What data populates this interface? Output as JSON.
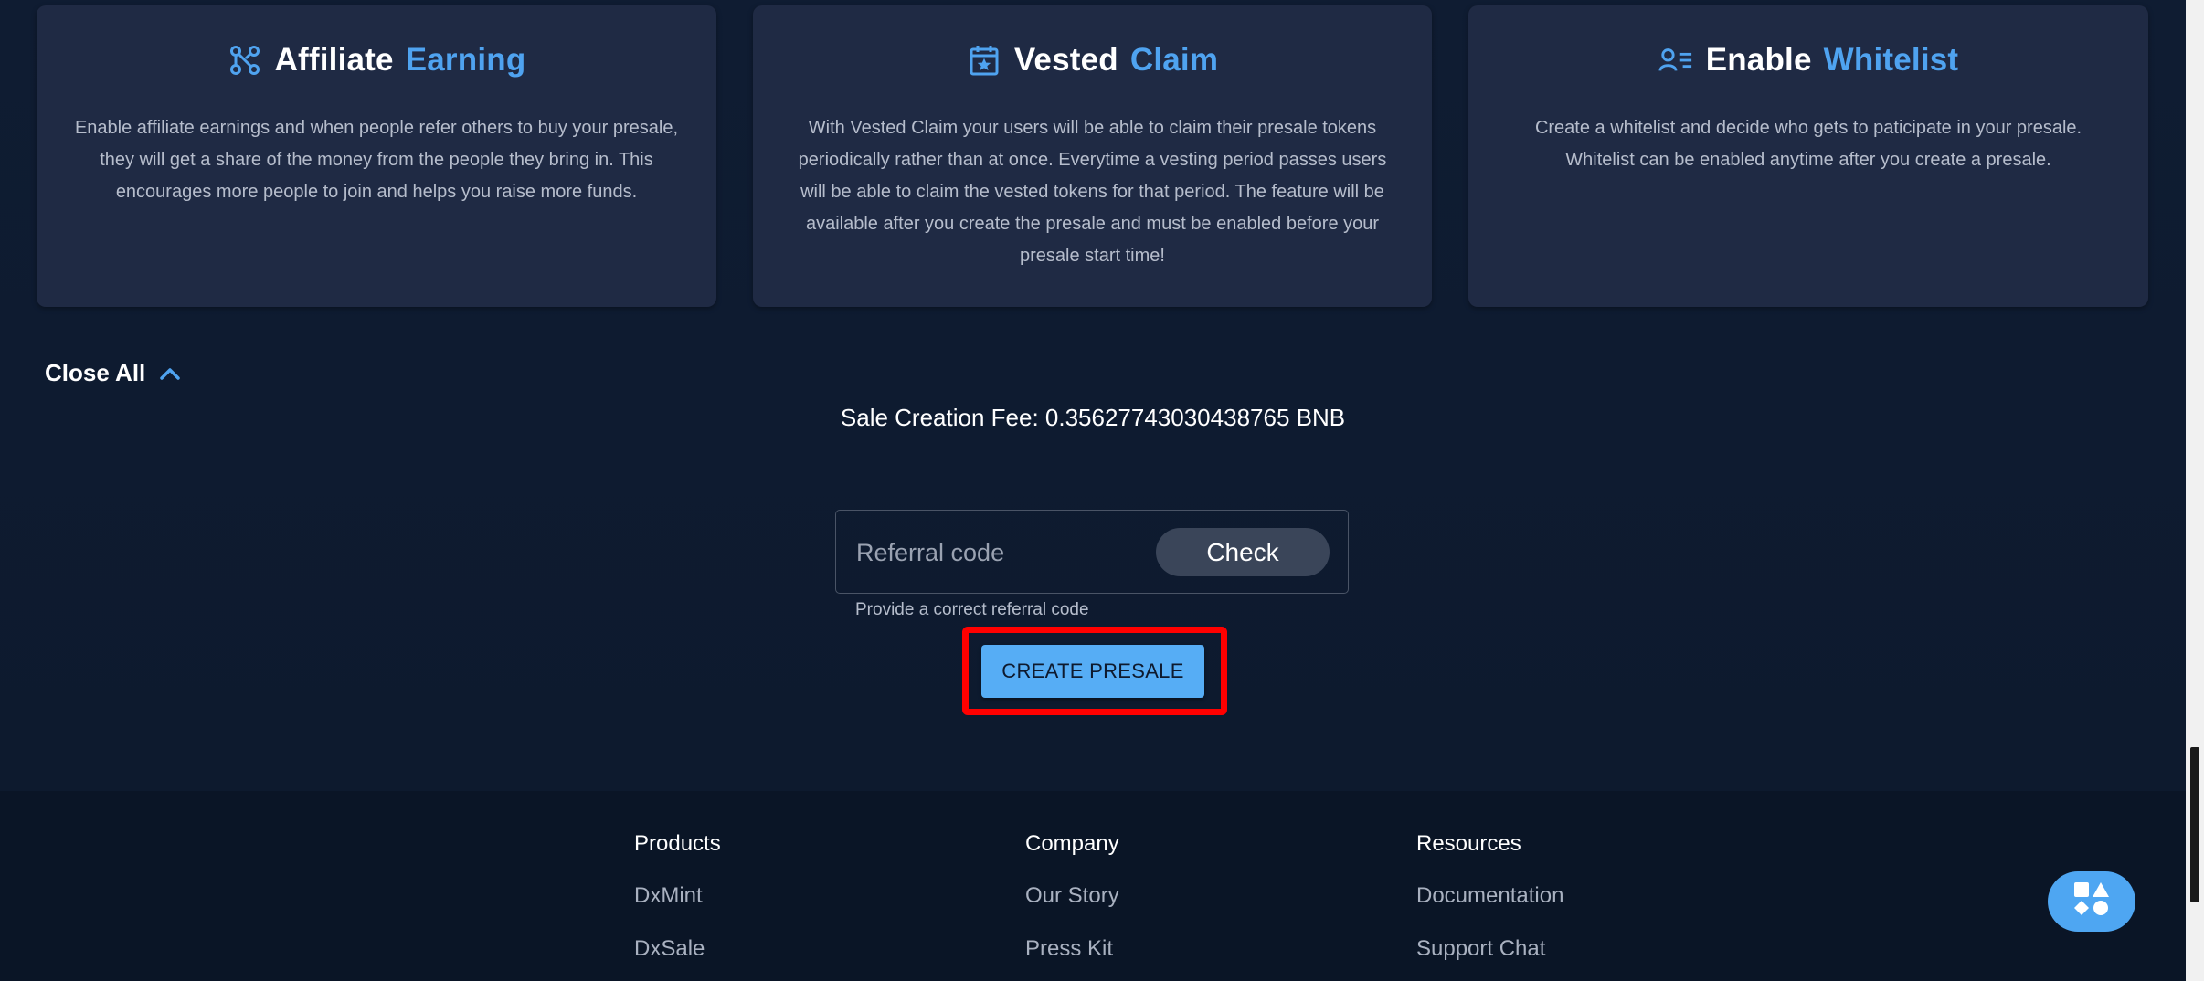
{
  "cards": [
    {
      "title_main": "Affiliate",
      "title_accent": "Earning",
      "icon": "affiliate-network-icon",
      "body": "Enable affiliate earnings and when people refer others to buy your presale, they will get a share of the money from the people they bring in. This encourages more people to join and helps you raise more funds."
    },
    {
      "title_main": "Vested",
      "title_accent": "Claim",
      "icon": "calendar-star-icon",
      "body": "With Vested Claim your users will be able to claim their presale tokens periodically rather than at once. Everytime a vesting period passes users will be able to claim the vested tokens for that period. The feature will be available after you create the presale and must be enabled before your presale start time!"
    },
    {
      "title_main": "Enable",
      "title_accent": "Whitelist",
      "icon": "user-list-icon",
      "body": "Create a whitelist and decide who gets to paticipate in your presale. Whitelist can be enabled anytime after you create a presale."
    }
  ],
  "close_all": {
    "label": "Close All",
    "icon": "chevron-up-icon"
  },
  "fee": {
    "text": "Sale Creation Fee: 0.35627743030438765 BNB"
  },
  "referral": {
    "placeholder": "Referral code",
    "value": "",
    "check_label": "Check",
    "helper": "Provide a correct referral code"
  },
  "create_presale": {
    "label": "CREATE PRESALE"
  },
  "footer": {
    "columns": [
      {
        "heading": "Products",
        "links": [
          "DxMint",
          "DxSale"
        ]
      },
      {
        "heading": "Company",
        "links": [
          "Our Story",
          "Press Kit"
        ]
      },
      {
        "heading": "Resources",
        "links": [
          "Documentation",
          "Support Chat"
        ]
      }
    ]
  },
  "fab": {
    "icon": "apps-shapes-icon"
  },
  "colors": {
    "accent": "#4fa3f0",
    "primary_button": "#56adf5",
    "highlight": "#ff0000",
    "card_bg": "#1f2a44",
    "page_bg": "#0e1a2e"
  }
}
